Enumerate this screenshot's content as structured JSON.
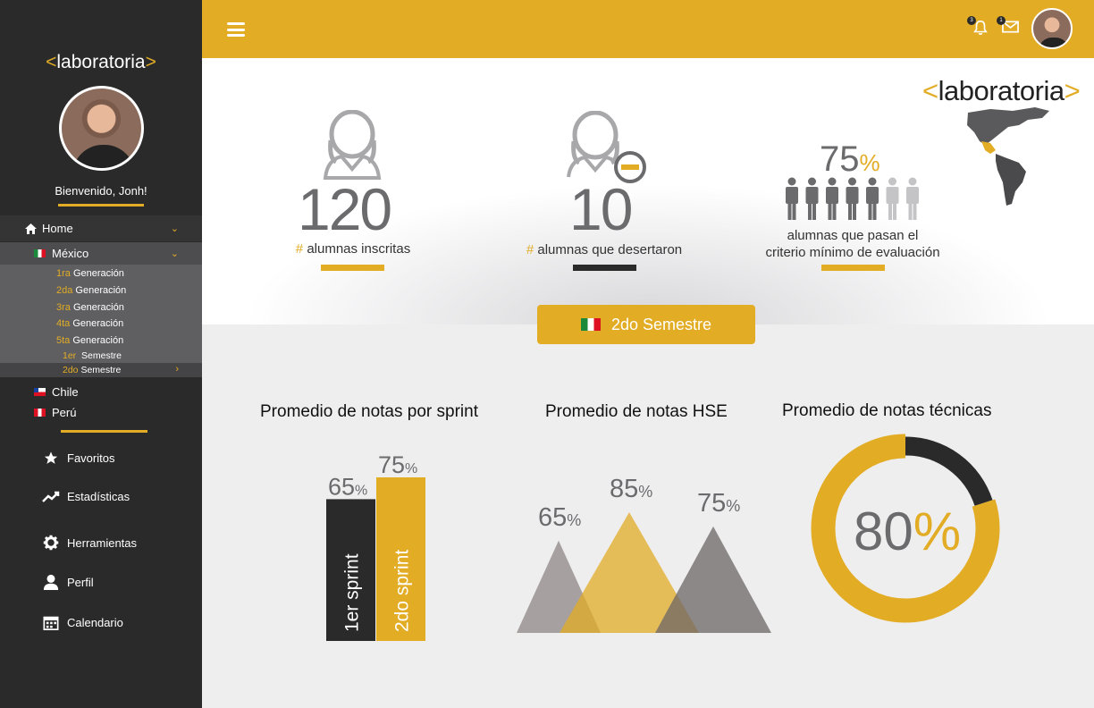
{
  "sidebar": {
    "brand_open": "<",
    "brand_name": "laboratoria",
    "brand_close": ">",
    "welcome": "Bienvenido, Jonh!",
    "home_label": "Home",
    "mexico_label": "México",
    "generations": [
      {
        "num": "1ra",
        "label": "Generación"
      },
      {
        "num": "2da",
        "label": "Generación"
      },
      {
        "num": "3ra",
        "label": "Generación"
      },
      {
        "num": "4ta",
        "label": "Generación"
      },
      {
        "num": "5ta",
        "label": "Generación"
      }
    ],
    "semesters": [
      {
        "num": "1er",
        "label": "Semestre"
      },
      {
        "num": "2do",
        "label": "Semestre"
      }
    ],
    "countries": [
      {
        "label": "Chile"
      },
      {
        "label": "Perú"
      }
    ],
    "menu": [
      {
        "label": "Favoritos",
        "icon": "star-icon"
      },
      {
        "label": "Estadísticas",
        "icon": "trend-icon"
      },
      {
        "label": "Herramientas",
        "icon": "gear-icon"
      },
      {
        "label": "Perfil",
        "icon": "user-icon"
      },
      {
        "label": "Calendario",
        "icon": "calendar-icon"
      }
    ]
  },
  "topbar": {
    "notifications_count": "3",
    "messages_count": "1"
  },
  "stats": {
    "enrolled_value": "120",
    "enrolled_hash": "#",
    "enrolled_label": "alumnas inscritas",
    "dropped_value": "10",
    "dropped_hash": "#",
    "dropped_label": "alumnas que desertaron",
    "pass_value": "75",
    "pass_symbol": "%",
    "pass_label_1": "alumnas que pasan el",
    "pass_label_2": "criterio mínimo de evaluación",
    "pass_people_total": 7,
    "pass_people_highlight": 5
  },
  "semester_button": "2do Semestre",
  "charts": {
    "sprint_title": "Promedio de notas por sprint",
    "hse_title": "Promedio de notas HSE",
    "tech_title": "Promedio de notas técnicas",
    "pct_symbol": "%",
    "donut_value": "80",
    "colors": {
      "accent": "#e2ac25",
      "dark": "#2a2a2b",
      "grey": "#6b6b6d"
    }
  },
  "chart_data": [
    {
      "type": "bar",
      "title": "Promedio de notas por sprint",
      "categories": [
        "1er sprint",
        "2do sprint"
      ],
      "values": [
        65,
        75
      ],
      "value_labels": [
        "65",
        "75"
      ],
      "colors": [
        "#2a2a2b",
        "#e2ac25"
      ]
    },
    {
      "type": "area",
      "title": "Promedio de notas HSE",
      "values": [
        65,
        85,
        75
      ],
      "value_labels": [
        "65",
        "85",
        "75"
      ],
      "colors": [
        "#8e8585",
        "#e2ac25",
        "#6b6565"
      ]
    },
    {
      "type": "pie",
      "title": "Promedio de notas técnicas",
      "values": [
        80,
        20
      ],
      "colors": [
        "#e2ac25",
        "#2a2a2b"
      ]
    }
  ]
}
